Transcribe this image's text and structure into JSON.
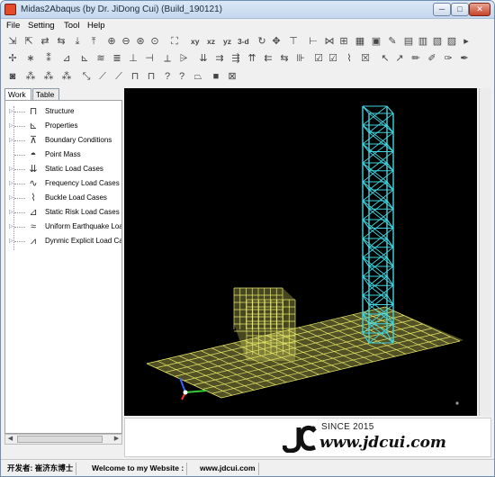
{
  "window": {
    "title": "Midas2Abaqus (by Dr. JiDong Cui) (Build_190121)",
    "controls": {
      "minimize": "─",
      "maximize": "□",
      "close": "✕"
    },
    "accent": "#e34b2c"
  },
  "menubar": {
    "items": [
      "File",
      "Setting",
      "Tool",
      "Help"
    ]
  },
  "toolbar": {
    "view_labels": {
      "xy": "xy",
      "xz": "xz",
      "yz": "yz",
      "three_d": "3-d"
    }
  },
  "panel": {
    "tabs": [
      "Work",
      "Table"
    ],
    "tree": [
      {
        "label": "Structure",
        "icon": "frame-icon"
      },
      {
        "label": "Properties",
        "icon": "section-icon"
      },
      {
        "label": "Boundary Conditions",
        "icon": "support-icon"
      },
      {
        "label": "Point Mass",
        "icon": "mass-icon"
      },
      {
        "label": "Static Load Cases",
        "icon": "static-load-icon"
      },
      {
        "label": "Frequency Load Cases",
        "icon": "frequency-icon"
      },
      {
        "label": "Buckle Load Cases",
        "icon": "buckle-icon"
      },
      {
        "label": "Static Risk Load Cases",
        "icon": "risk-icon"
      },
      {
        "label": "Uniform Earthquake Load",
        "icon": "earthquake-icon"
      },
      {
        "label": "Dynmic Explicit Load Case",
        "icon": "explicit-icon"
      }
    ]
  },
  "viewport": {
    "background": "#000000",
    "tower_color": "#3fd6e0",
    "slab_color": "#e8e86a"
  },
  "banner": {
    "since": "SINCE 2015",
    "website": "www.jdcui.com"
  },
  "statusbar": {
    "developer": "开发者: 崔济东博士",
    "welcome": "Welcome to my Website :",
    "url": "www.jdcui.com"
  }
}
